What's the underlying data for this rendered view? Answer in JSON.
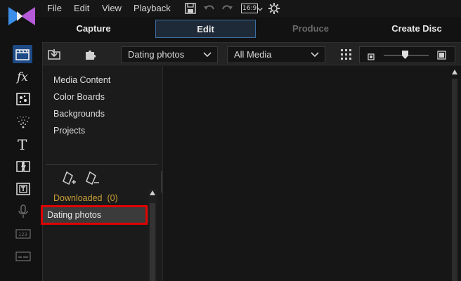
{
  "menu": {
    "file": "File",
    "edit": "Edit",
    "view": "View",
    "playback": "Playback"
  },
  "toolbar": {
    "aspect_ratio": "16:9"
  },
  "modes": {
    "capture": "Capture",
    "edit": "Edit",
    "produce": "Produce",
    "create_disc": "Create Disc"
  },
  "library": {
    "tag_dropdown": "Dating photos",
    "filter_dropdown": "All Media",
    "tree": {
      "items": [
        "Media Content",
        "Color Boards",
        "Backgrounds",
        "Projects"
      ],
      "downloaded": "Downloaded  (0)",
      "selected_tag": "Dating photos"
    }
  },
  "colors": {
    "accent": "#3d6fa3",
    "media_tool": "#1e4a86",
    "highlight": "#e00000",
    "downloaded": "#c9a036"
  },
  "icons": [
    "app-logo-icon",
    "save-icon",
    "undo-icon",
    "redo-icon",
    "chevron-down-icon",
    "settings-gear-icon",
    "media-room-icon",
    "fx-icon",
    "pip-icon",
    "particle-icon",
    "title-icon",
    "transition-icon",
    "subtitle-icon",
    "microphone-icon",
    "chapter-icon",
    "subtitle-room-icon",
    "import-media-icon",
    "plugin-icon",
    "grid-view-icon",
    "small-thumbnail-icon",
    "large-thumbnail-icon",
    "add-tag-icon",
    "remove-tag-icon",
    "collapse-left-icon"
  ]
}
